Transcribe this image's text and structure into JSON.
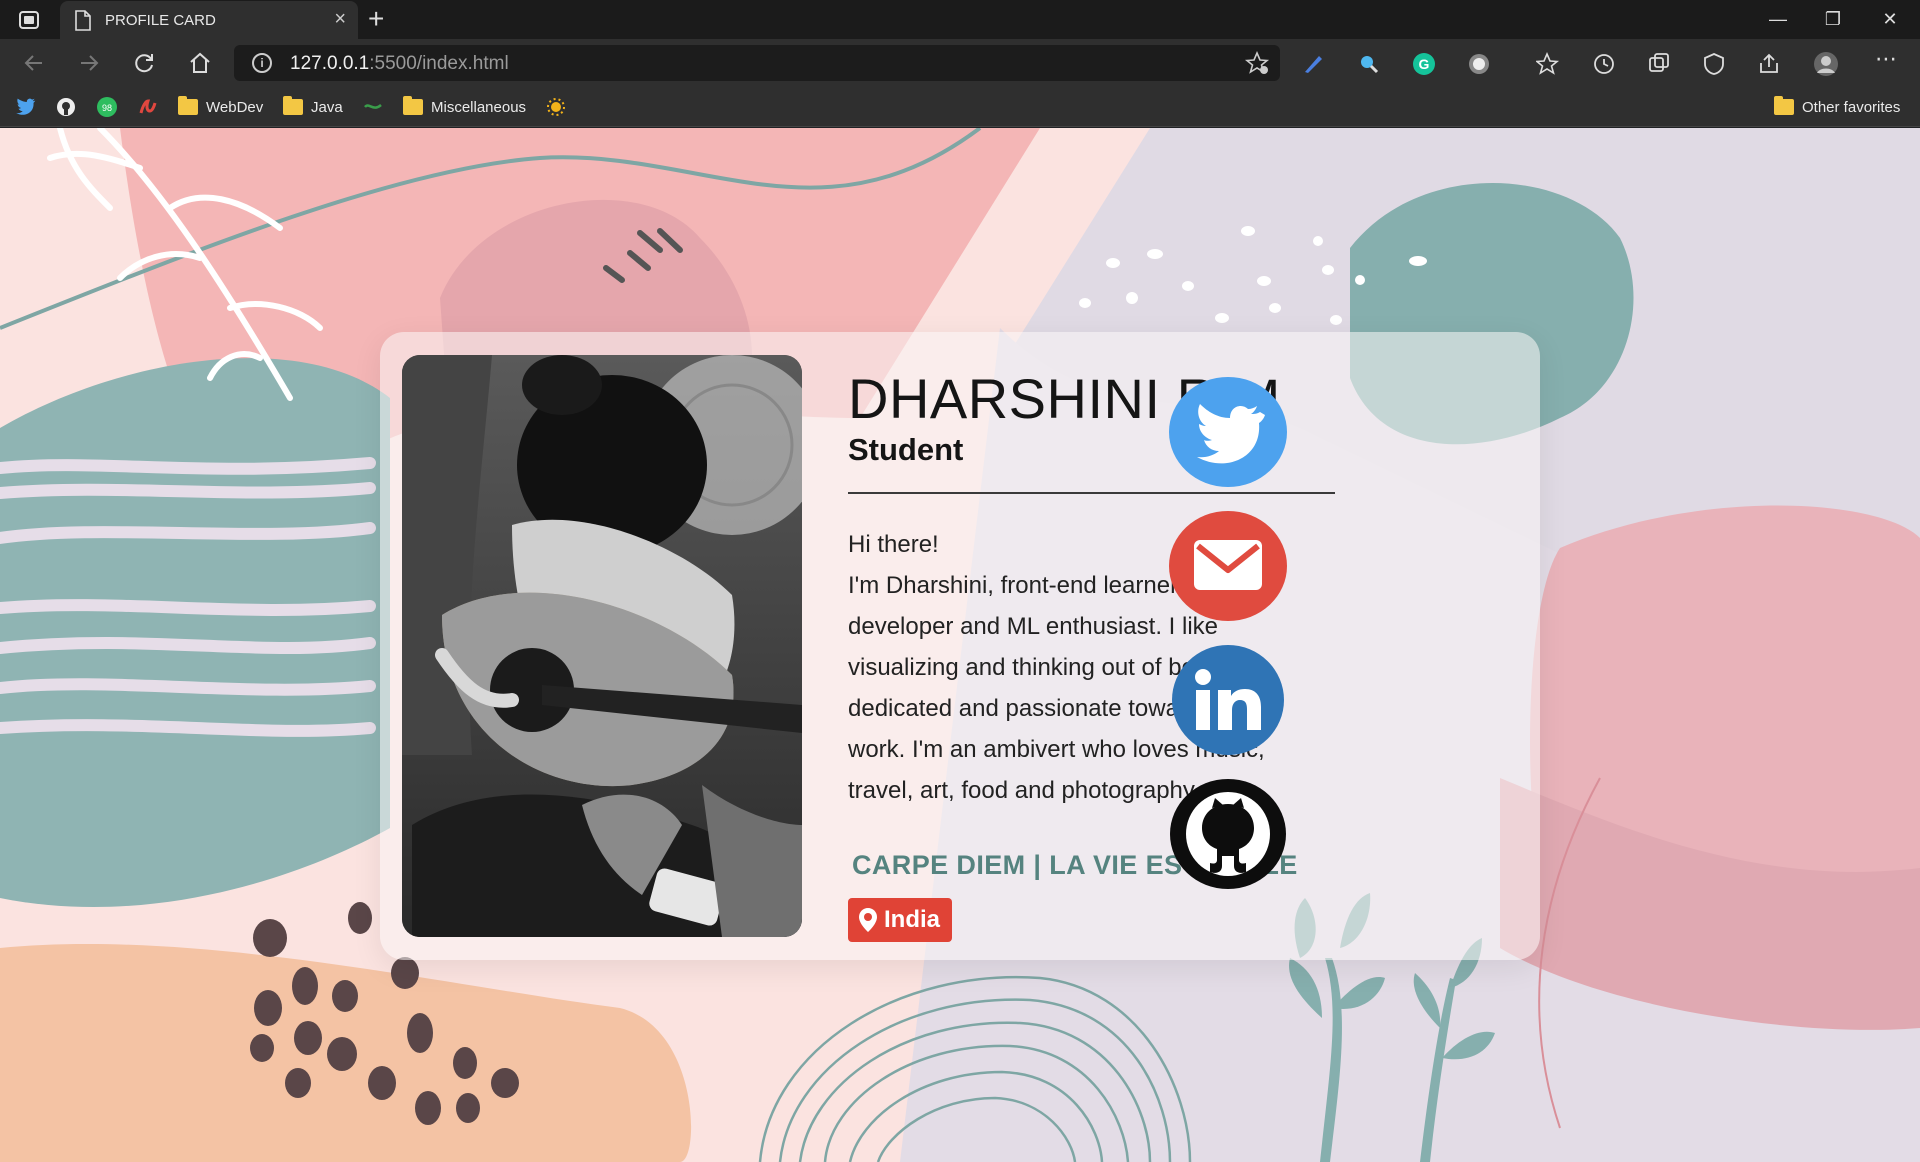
{
  "browser": {
    "tab_title": "PROFILE CARD",
    "url_host": "127.0.0.1",
    "url_path": ":5500/index.html",
    "bookmarks": [
      {
        "icon": "twitter-icon"
      },
      {
        "icon": "github-icon"
      },
      {
        "icon": "whatsapp-icon",
        "badge": "98"
      },
      {
        "icon": "brand-icon"
      },
      {
        "label": "WebDev",
        "icon": "folder-icon"
      },
      {
        "label": "Java",
        "icon": "folder-icon"
      },
      {
        "icon": "extension-icon"
      },
      {
        "label": "Miscellaneous",
        "icon": "folder-icon"
      },
      {
        "icon": "sun-icon"
      }
    ],
    "other_favorites": "Other favorites"
  },
  "profile": {
    "name": "DHARSHINI R M",
    "role": "Student",
    "bio_lines": [
      "Hi there!",
      "I'm Dharshini, front-end learner / developer and ML enthusiast. I like visualizing and thinking out of box. I'm dedicated and passionate towards my work. I'm an ambivert who loves music, travel, art, food and photography."
    ],
    "motto": "CARPE DIEM | LA VIE EST BELLE",
    "location": "India"
  },
  "social": [
    {
      "name": "twitter",
      "color": "#4da2ee"
    },
    {
      "name": "email",
      "color": "#e04b3f"
    },
    {
      "name": "linkedin",
      "color": "#2f74b5"
    },
    {
      "name": "github",
      "color": "#0d0d0d"
    }
  ],
  "colors": {
    "accent_teal": "#55837f",
    "location_badge": "#e04336",
    "background": "#fbe3e0"
  }
}
